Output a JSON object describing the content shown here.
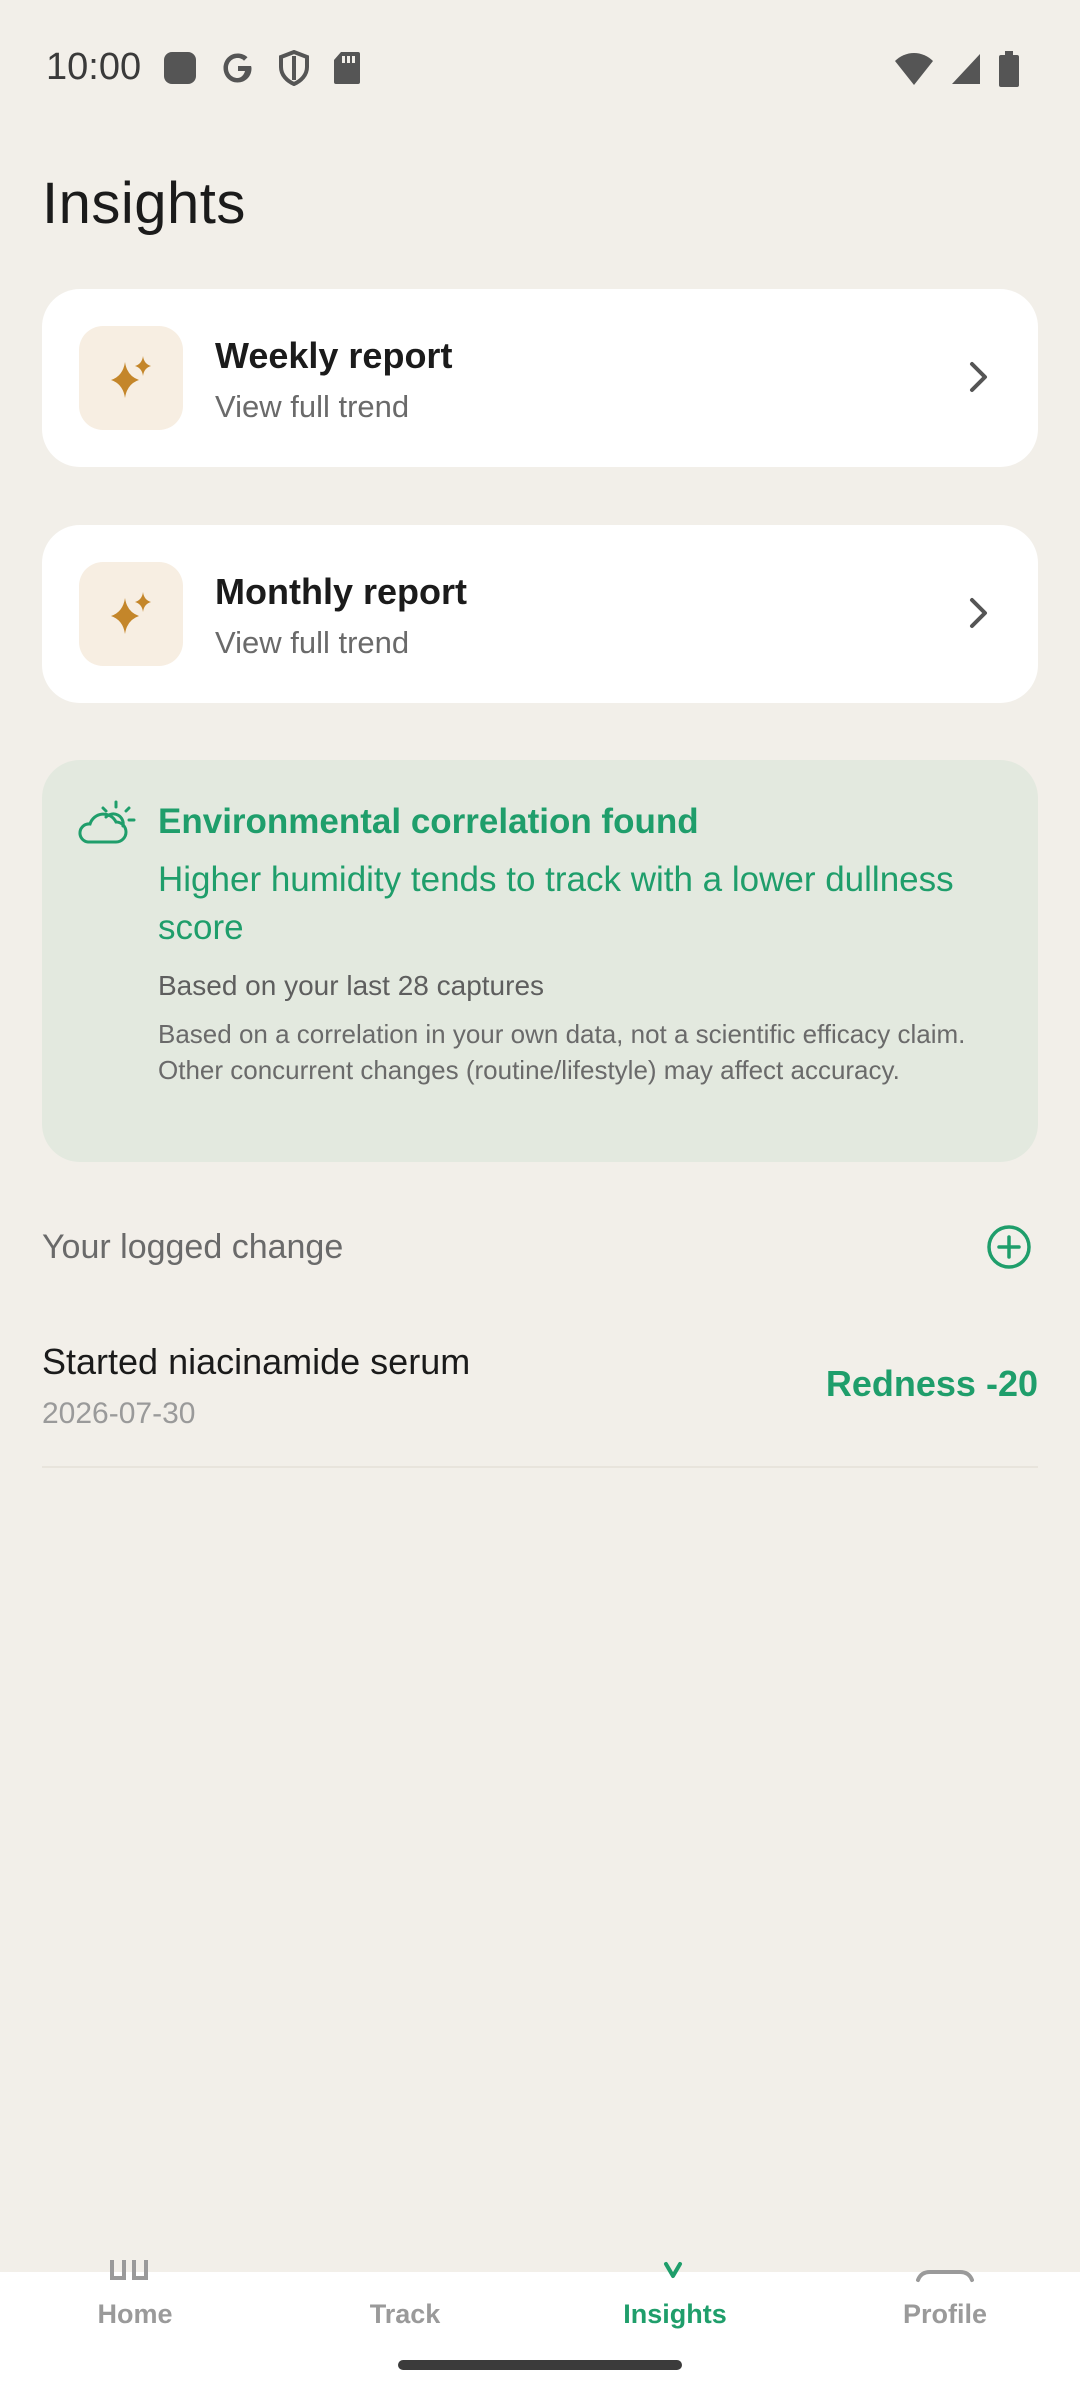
{
  "status_bar": {
    "time": "10:00",
    "left_icons": [
      "app-icon",
      "google-icon",
      "shield-icon",
      "sd-card-icon"
    ],
    "right_icons": [
      "wifi-icon",
      "signal-icon",
      "battery-icon"
    ]
  },
  "page": {
    "title": "Insights"
  },
  "reports": [
    {
      "title": "Weekly report",
      "subtitle": "View full trend",
      "icon": "sparkles-icon"
    },
    {
      "title": "Monthly report",
      "subtitle": "View full trend",
      "icon": "sparkles-icon"
    }
  ],
  "environment_card": {
    "icon": "partly-cloudy-icon",
    "title": "Environmental correlation found",
    "description": "Higher humidity tends to track with a lower dullness score",
    "basis": "Based on your last 28 captures",
    "disclaimer": "Based on a correlation in your own data, not a scientific efficacy claim. Other concurrent changes (routine/lifestyle) may affect accuracy."
  },
  "logged_changes": {
    "section_title": "Your logged change",
    "items": [
      {
        "title": "Started niacinamide serum",
        "date": "2026-07-30",
        "effect": "Redness -20"
      }
    ]
  },
  "bottom_nav": {
    "items": [
      {
        "label": "Home",
        "icon": "home-icon"
      },
      {
        "label": "Track",
        "icon": "track-icon"
      },
      {
        "label": "Insights",
        "icon": "insights-icon",
        "active": true
      },
      {
        "label": "Profile",
        "icon": "profile-icon"
      }
    ]
  },
  "colors": {
    "background": "#F2EFE9",
    "accent_green": "#1F9E6B",
    "accent_gold": "#C4862A",
    "env_card_bg": "#E3E9DF"
  }
}
